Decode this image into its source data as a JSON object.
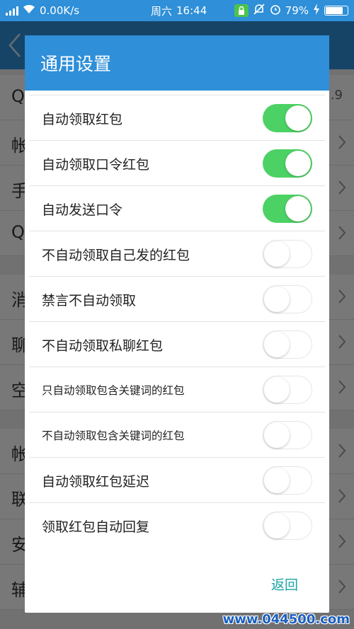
{
  "status_bar": {
    "net_speed": "0.00K/s",
    "day": "周六",
    "time": "16:44",
    "battery": "79%",
    "battery_level": 0.79
  },
  "background": {
    "rows": [
      {
        "char": "Q",
        "extra": ".9"
      },
      {
        "char": "帐",
        "extra": ""
      },
      {
        "char": "手",
        "extra": ""
      },
      {
        "char": "Q",
        "extra": ""
      },
      {
        "char": "消",
        "extra": ""
      },
      {
        "char": "聊",
        "extra": ""
      },
      {
        "char": "空",
        "extra": ""
      },
      {
        "char": "帐",
        "extra": ""
      },
      {
        "char": "联",
        "extra": ""
      },
      {
        "char": "安",
        "extra": ""
      },
      {
        "char": "辅",
        "extra": ""
      }
    ]
  },
  "dialog": {
    "title": "通用设置",
    "items": [
      {
        "label": "自动领取红包",
        "on": true
      },
      {
        "label": "自动领取口令红包",
        "on": true
      },
      {
        "label": "自动发送口令",
        "on": true
      },
      {
        "label": "不自动领取自己发的红包",
        "on": false
      },
      {
        "label": "禁言不自动领取",
        "on": false
      },
      {
        "label": "不自动领取私聊红包",
        "on": false
      },
      {
        "label": "只自动领取包含关键词的红包",
        "on": false
      },
      {
        "label": "不自动领取包含关键词的红包",
        "on": false
      },
      {
        "label": "自动领取红包延迟",
        "on": false
      },
      {
        "label": "领取红包自动回复",
        "on": false
      }
    ],
    "back_label": "返回"
  },
  "watermark": "www.044500.com",
  "colors": {
    "accent": "#2f8fd8",
    "toggle_on": "#4cd264",
    "back_button": "#1aa3a3"
  }
}
